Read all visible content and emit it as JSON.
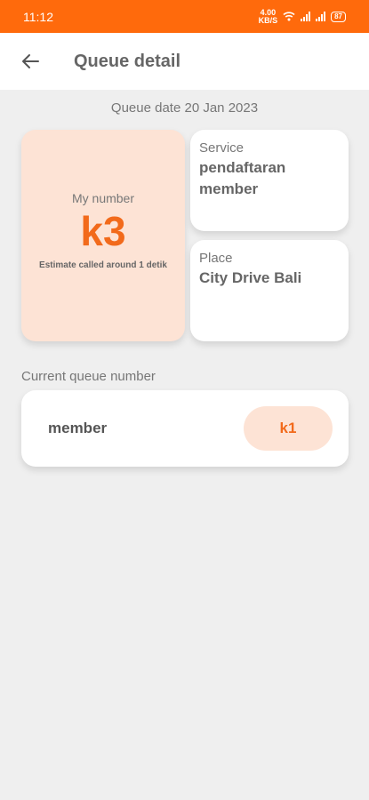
{
  "status_bar": {
    "time": "11:12",
    "network_speed": "4.00\nKB/S",
    "battery": "87",
    "icons": [
      "wifi-icon",
      "signal-icon",
      "signal-icon",
      "battery-icon"
    ]
  },
  "header": {
    "title": "Queue detail",
    "back_icon": "arrow-left-icon"
  },
  "queue_date": "Queue date 20 Jan 2023",
  "my_number": {
    "label": "My number",
    "value": "k3",
    "estimate": "Estimate called around 1 detik"
  },
  "service": {
    "label": "Service",
    "value": "pendaftaran member"
  },
  "place": {
    "label": "Place",
    "value": "City Drive Bali"
  },
  "current_queue": {
    "label": "Current queue number",
    "service": "member",
    "number": "k1"
  },
  "colors": {
    "accent": "#ff6a0c",
    "number_text": "#f26a1b",
    "number_bg": "#fde3d5",
    "background": "#efefef"
  }
}
